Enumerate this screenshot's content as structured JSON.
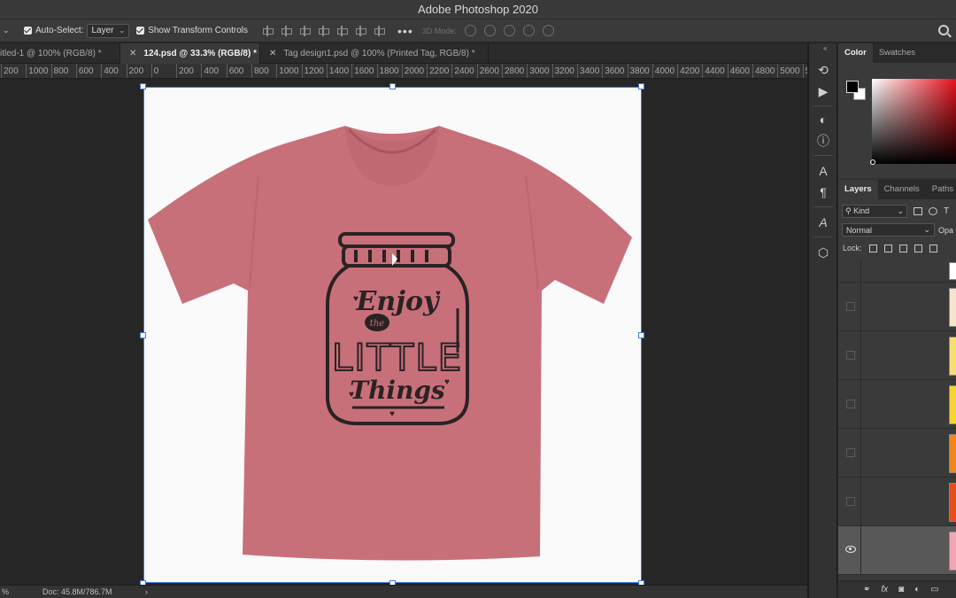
{
  "app": {
    "title": "Adobe Photoshop 2020"
  },
  "options_bar": {
    "auto_select_label": "Auto-Select:",
    "auto_select_value": "Layer",
    "show_transform_label": "Show Transform Controls",
    "mode_3d_label": "3D Mode:",
    "more_label": "•••"
  },
  "tabs": [
    {
      "label": "itled-1 @ 100% (RGB/8) *",
      "active": false
    },
    {
      "label": "124.psd @ 33.3% (RGB/8) *",
      "active": true
    },
    {
      "label": "Tag design1.psd @ 100% (Printed Tag, RGB/8) *",
      "active": false
    }
  ],
  "ruler": {
    "ticks": [
      "200",
      "1000",
      "800",
      "600",
      "400",
      "200",
      "0",
      "200",
      "400",
      "600",
      "800",
      "1000",
      "1200",
      "1400",
      "1600",
      "1800",
      "2000",
      "2200",
      "2400",
      "2600",
      "2800",
      "3000",
      "3200",
      "3400",
      "3600",
      "3800",
      "4000",
      "4200",
      "4400",
      "4600",
      "4800",
      "5000",
      "5"
    ]
  },
  "design": {
    "line1": "Enjoy",
    "line2": "the",
    "line3": "LITTLE",
    "line4": "Things",
    "shirt_color": "#c8707a",
    "ink_color": "#2a2224"
  },
  "status": {
    "zoom": "%",
    "doc": "Doc: 45.8M/786.7M",
    "arrow": "›"
  },
  "color_panel": {
    "tabs": [
      "Color",
      "Swatches"
    ],
    "foreground": "#000000",
    "background": "#ffffff"
  },
  "layers_panel": {
    "tabs": [
      "Layers",
      "Channels",
      "Paths"
    ],
    "filter_label": "Kind",
    "blend_mode": "Normal",
    "opacity_label": "Opa",
    "lock_label": "Lock:",
    "layer_swatches": [
      "#ffffff",
      "#f7e4cc",
      "#f7dc7a",
      "#f6d432",
      "#f0861e",
      "#e44d1e",
      "#f2a6b4"
    ]
  }
}
